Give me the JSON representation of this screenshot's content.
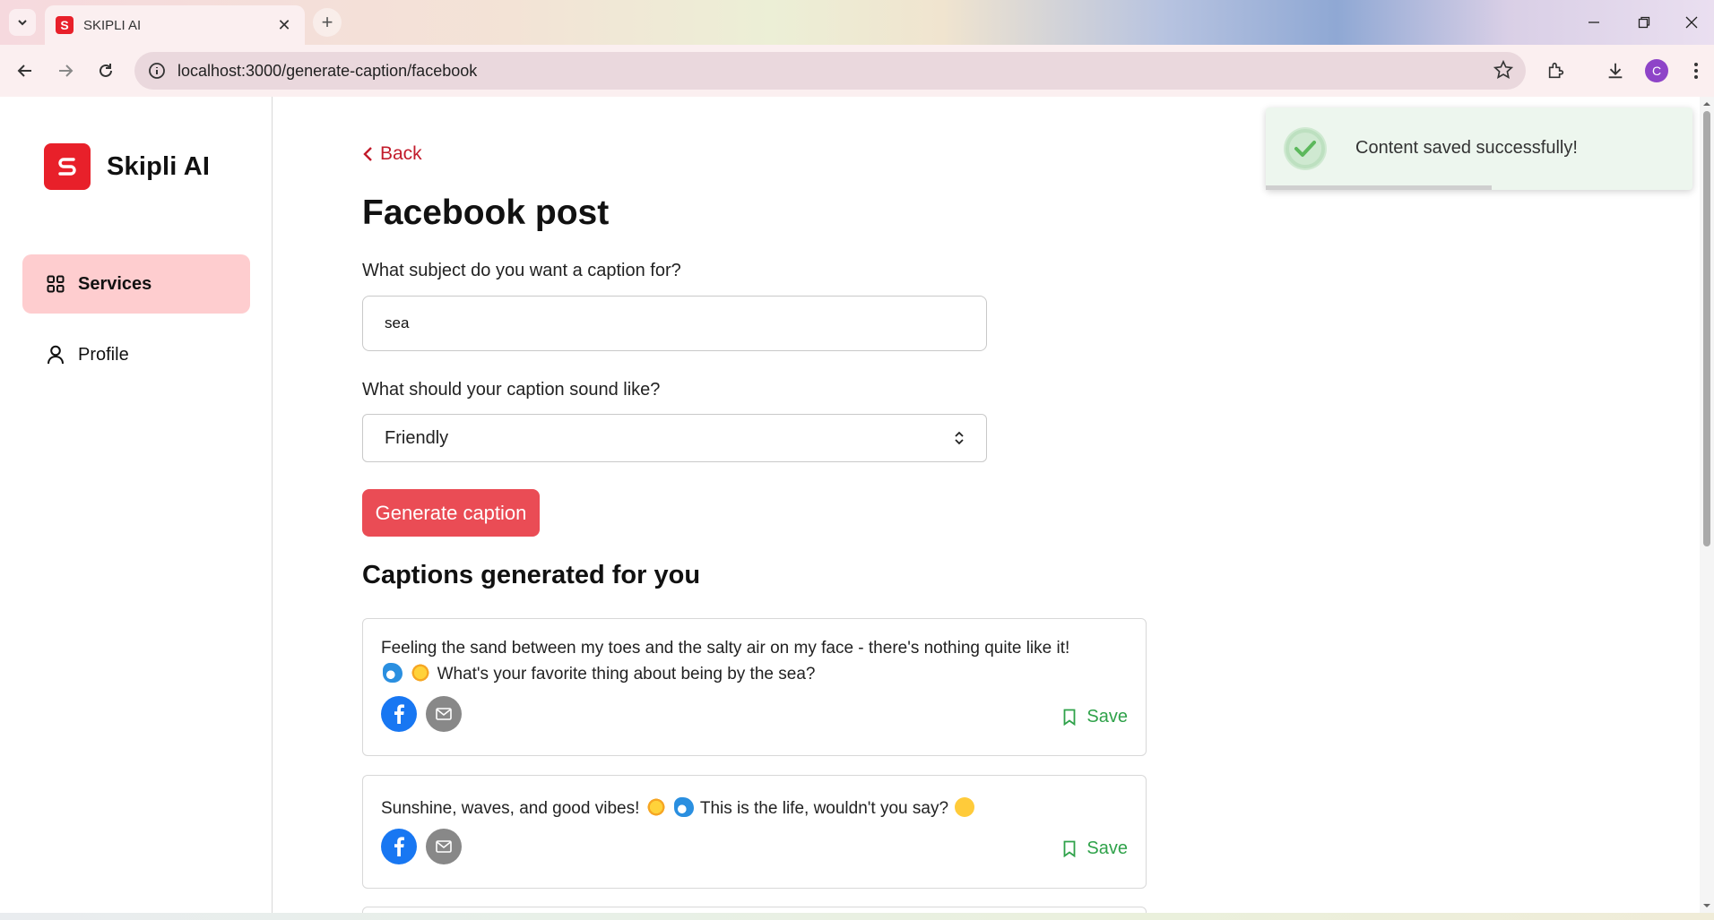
{
  "browser": {
    "tab_title": "SKIPLI AI",
    "tab_favicon": "S",
    "url": "localhost:3000/generate-caption/facebook",
    "profile_initial": "C"
  },
  "sidebar": {
    "brand_name": "Skipli AI",
    "items": [
      {
        "label": "Services",
        "icon": "grid-icon",
        "active": true
      },
      {
        "label": "Profile",
        "icon": "user-icon",
        "active": false
      }
    ]
  },
  "main": {
    "back_label": "Back",
    "title": "Facebook post",
    "subject_label": "What subject do you want a caption for?",
    "subject_value": "sea",
    "tone_label": "What should your caption sound like?",
    "tone_value": "Friendly",
    "generate_label": "Generate caption",
    "section_title": "Captions generated for you",
    "save_label": "Save",
    "captions": [
      {
        "line1": "Feeling the sand between my toes and the salty air on my face - there's nothing quite like it!",
        "line2": "What's your favorite thing about being by the sea?"
      },
      {
        "part1": "Sunshine, waves, and good vibes!",
        "part2": "This is the life, wouldn't you say?"
      }
    ]
  },
  "toast": {
    "message": "Content saved successfully!",
    "progress": 0.53
  },
  "colors": {
    "brand": "#e8202a",
    "active_nav": "#fecdcf",
    "button": "#ea4c55",
    "save": "#2fa24a",
    "facebook": "#1877f2"
  }
}
